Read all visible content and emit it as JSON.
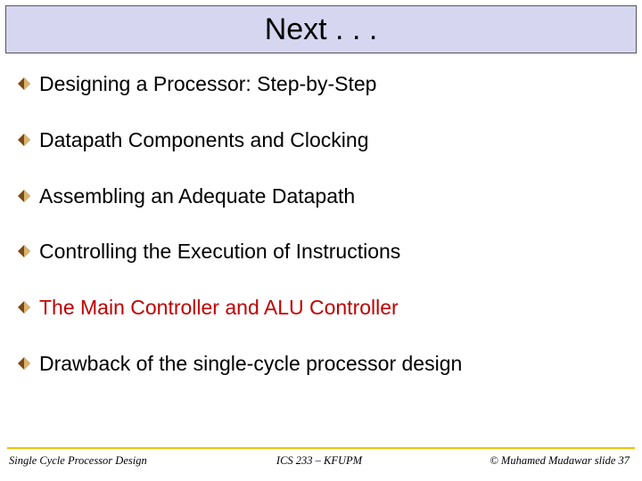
{
  "title": "Next . . .",
  "bullets": [
    {
      "text": "Designing a Processor: Step-by-Step",
      "highlight": false
    },
    {
      "text": "Datapath Components and Clocking",
      "highlight": false
    },
    {
      "text": "Assembling an Adequate Datapath",
      "highlight": false
    },
    {
      "text": "Controlling the Execution of Instructions",
      "highlight": false
    },
    {
      "text": "The Main Controller and ALU Controller",
      "highlight": true
    },
    {
      "text": "Drawback of the single-cycle processor design",
      "highlight": false
    }
  ],
  "footer": {
    "left": "Single Cycle Processor Design",
    "center": "ICS 233 – KFUPM",
    "right": "© Muhamed Mudawar   slide 37"
  },
  "colors": {
    "titleBg": "#d6d6f0",
    "highlight": "#c00000",
    "accentRule": "#f2c000",
    "diamondDark": "#7a4a1a",
    "diamondLight": "#d9b36b"
  }
}
